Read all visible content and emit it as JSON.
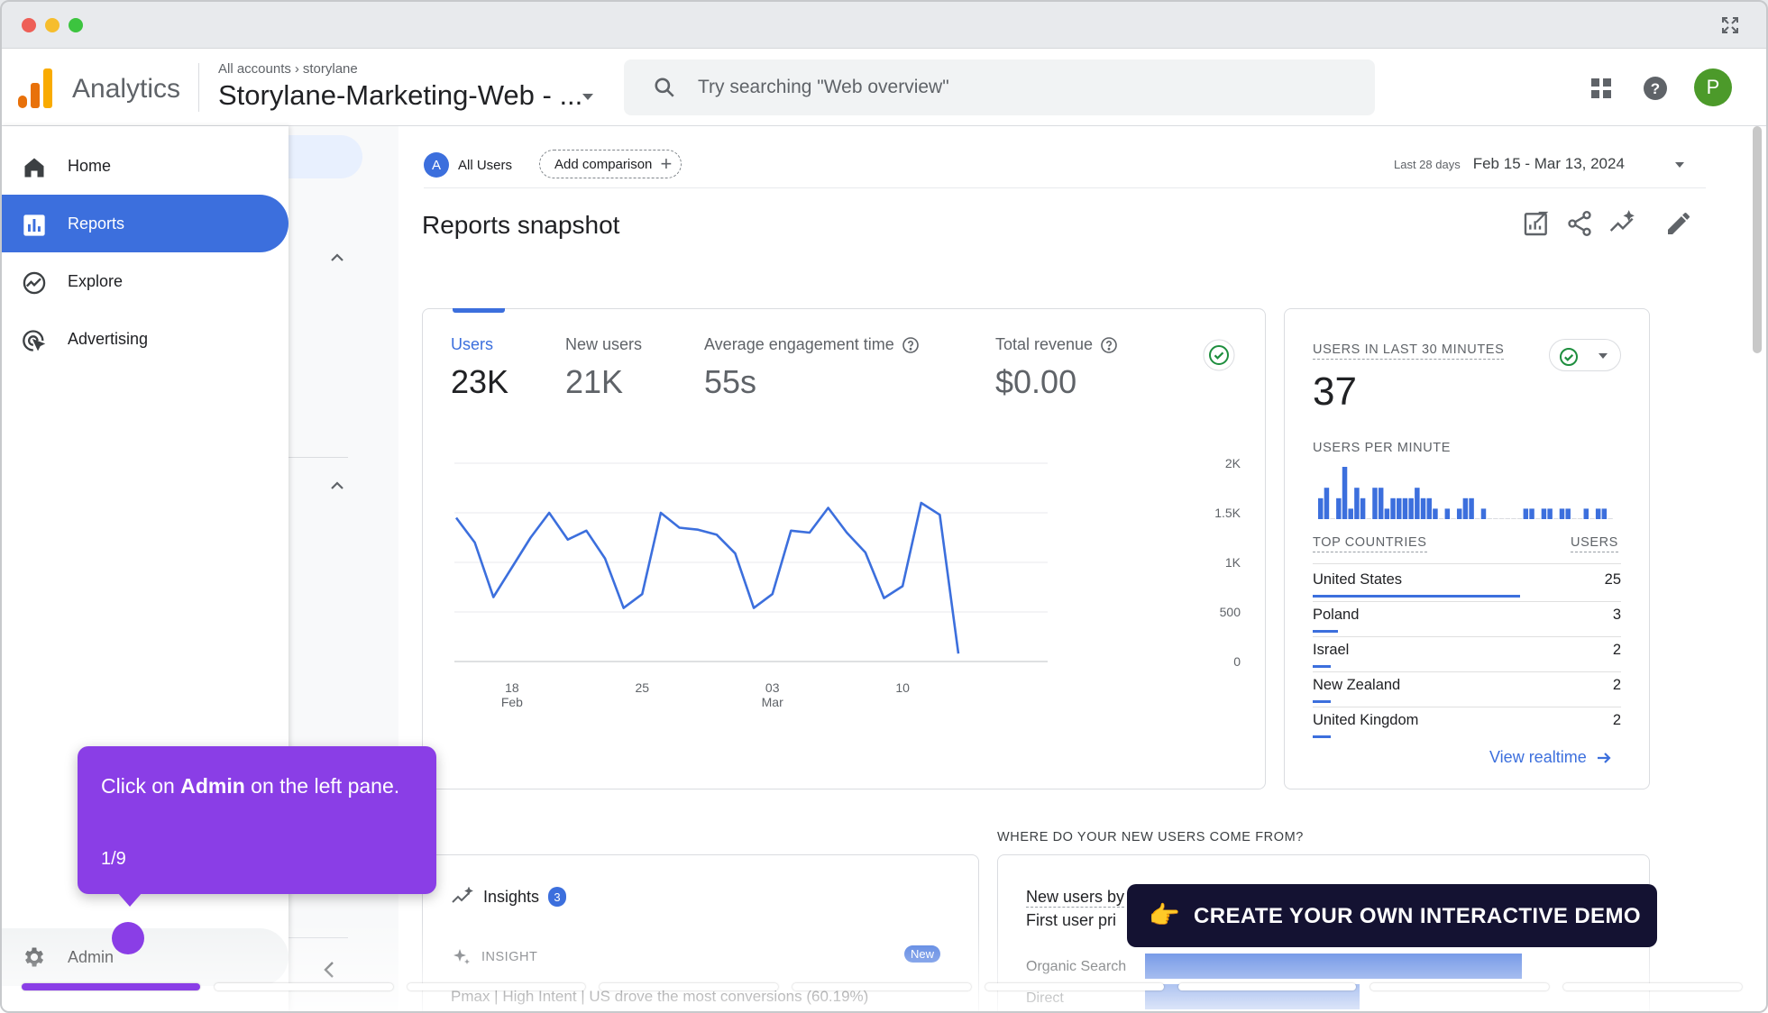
{
  "window": {
    "expand_icon": "expand-icon"
  },
  "header": {
    "brand": "Analytics",
    "breadcrumb": {
      "root": "All accounts",
      "account": "storylane"
    },
    "property": "Storylane-Marketing-Web - ...",
    "search_placeholder": "Try searching \"Web overview\"",
    "avatar_letter": "P"
  },
  "nav": {
    "items": [
      {
        "label": "Home",
        "icon": "home-icon"
      },
      {
        "label": "Reports",
        "icon": "reports-icon",
        "active": true
      },
      {
        "label": "Explore",
        "icon": "explore-icon"
      },
      {
        "label": "Advertising",
        "icon": "advertising-icon"
      }
    ],
    "admin_label": "Admin"
  },
  "filters": {
    "segment_letter": "A",
    "segment": "All Users",
    "add_comparison": "Add comparison",
    "date_label": "Last 28 days",
    "date_value": "Feb 15 - Mar 13, 2024"
  },
  "page": {
    "title": "Reports snapshot"
  },
  "metrics": [
    {
      "label": "Users",
      "value": "23K",
      "active": true
    },
    {
      "label": "New users",
      "value": "21K"
    },
    {
      "label": "Average engagement time",
      "value": "55s",
      "help": true
    },
    {
      "label": "Total revenue",
      "value": "$0.00",
      "help": true
    }
  ],
  "chart_data": {
    "type": "line",
    "series": [
      {
        "values": [
          1450,
          1200,
          650,
          950,
          1250,
          1500,
          1230,
          1320,
          1040,
          540,
          680,
          1500,
          1350,
          1330,
          1280,
          1090,
          540,
          680,
          1320,
          1300,
          1550,
          1300,
          1100,
          640,
          760,
          1600,
          1480,
          80
        ]
      }
    ],
    "x_start": "Feb 15",
    "x_ticks": [
      {
        "label": "18",
        "sub": "Feb",
        "index": 3
      },
      {
        "label": "25",
        "sub": "",
        "index": 10
      },
      {
        "label": "03",
        "sub": "Mar",
        "index": 17
      },
      {
        "label": "10",
        "sub": "",
        "index": 24
      }
    ],
    "y_ticks": [
      "0",
      "500",
      "1K",
      "1.5K",
      "2K"
    ],
    "ylim": [
      0,
      2000
    ],
    "grid": true,
    "color": "#3c6fdd"
  },
  "realtime": {
    "title": "USERS IN LAST 30 MINUTES",
    "value": "37",
    "per_minute_label": "USERS PER MINUTE",
    "per_minute": [
      2,
      3,
      0,
      2,
      5,
      1,
      3,
      2,
      0,
      3,
      3,
      1,
      2,
      2,
      2,
      2,
      3,
      2,
      2,
      1,
      0,
      1,
      0,
      1,
      2,
      2,
      0,
      1,
      0,
      0,
      0,
      0,
      0,
      0,
      1,
      1,
      0,
      1,
      1,
      0,
      1,
      1,
      0,
      0,
      1,
      0,
      1,
      1,
      0
    ],
    "countries_header": "TOP COUNTRIES",
    "users_header": "USERS",
    "countries": [
      {
        "name": "United States",
        "users": "25",
        "share": 1.0
      },
      {
        "name": "Poland",
        "users": "3",
        "share": 0.12
      },
      {
        "name": "Israel",
        "users": "2",
        "share": 0.08
      },
      {
        "name": "New Zealand",
        "users": "2",
        "share": 0.08
      },
      {
        "name": "United Kingdom",
        "users": "2",
        "share": 0.08
      }
    ],
    "link": "View realtime"
  },
  "where": {
    "title": "WHERE DO YOUR NEW USERS COME FROM?",
    "chart_title_1": "New users by",
    "chart_title_2": "First user pri",
    "rows": [
      {
        "label": "Organic Search",
        "share": 1.0
      },
      {
        "label": "Direct",
        "share": 0.57
      }
    ]
  },
  "insights": {
    "title": "Insights",
    "count": "3",
    "sub": "INSIGHT",
    "badge": "New",
    "text": "Pmax | High Intent | US drove the most conversions (60.19%)"
  },
  "tooltip": {
    "before": "Click on ",
    "bold": "Admin",
    "after": " on the left pane.",
    "step": "1/9"
  },
  "cta": {
    "emoji": "👉",
    "label": "CREATE YOUR OWN INTERACTIVE DEMO"
  },
  "progress": {
    "segments": 9,
    "current": 1,
    "fill_fraction": 1.0
  }
}
